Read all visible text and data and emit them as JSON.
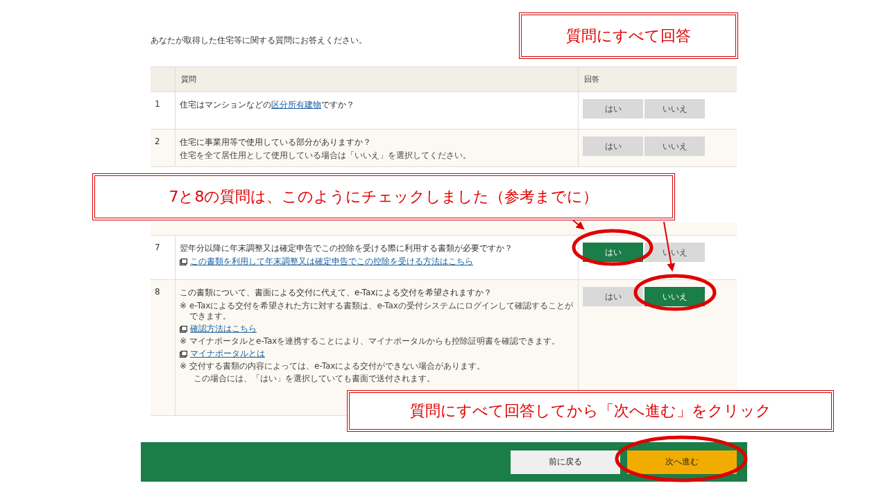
{
  "intro": "あなたが取得した住宅等に関する質問にお答えください。",
  "table": {
    "columns": [
      "質問",
      "回答"
    ],
    "rows": [
      {
        "number": "1",
        "question": [
          {
            "kind": "text",
            "text": "住宅はマンションなどの"
          },
          {
            "kind": "link",
            "text": "区分所有建物"
          },
          {
            "kind": "text",
            "text": "ですか？"
          }
        ],
        "details": [],
        "answers": [
          {
            "label": "はい",
            "selected": false
          },
          {
            "label": "いいえ",
            "selected": false
          }
        ]
      },
      {
        "number": "2",
        "question": [
          {
            "kind": "text",
            "text": "住宅に事業用等で使用している部分がありますか？"
          }
        ],
        "details": [
          {
            "kind": "plain",
            "text": "住宅を全て居住用として使用している場合は「いいえ」を選択してください。"
          }
        ],
        "answers": [
          {
            "label": "はい",
            "selected": false
          },
          {
            "label": "いいえ",
            "selected": false
          }
        ]
      },
      {
        "number": "7",
        "question": [
          {
            "kind": "text",
            "text": "翌年分以降に年末調整又は確定申告でこの控除を受ける際に利用する書類が必要ですか？"
          }
        ],
        "details": [
          {
            "kind": "link",
            "text": "この書類を利用して年末調整又は確定申告でこの控除を受ける方法はこちら"
          }
        ],
        "answers": [
          {
            "label": "はい",
            "selected": true
          },
          {
            "label": "いいえ",
            "selected": false
          }
        ]
      },
      {
        "number": "8",
        "question": [
          {
            "kind": "text",
            "text": "この書類について、書面による交付に代えて、e-Taxによる交付を希望されますか？"
          }
        ],
        "details": [
          {
            "kind": "note",
            "mark": "※",
            "text": "e-Taxによる交付を希望された方に対する書類は、e-Taxの受付システムにログインして確認することができます。"
          },
          {
            "kind": "link",
            "text": "確認方法はこちら"
          },
          {
            "kind": "note",
            "mark": "※",
            "text": "マイナポータルとe-Taxを連携することにより、マイナポータルからも控除証明書を確認できます。"
          },
          {
            "kind": "link",
            "text": "マイナポータルとは"
          },
          {
            "kind": "note",
            "mark": "※",
            "text": "交付する書類の内容によっては、e-Taxによる交付ができない場合があります。"
          },
          {
            "kind": "sub",
            "text": "この場合には、「はい」を選択していても書面で送付されます。"
          }
        ],
        "answers": [
          {
            "label": "はい",
            "selected": false
          },
          {
            "label": "いいえ",
            "selected": true
          }
        ]
      }
    ]
  },
  "footer": {
    "buttons": [
      {
        "label": "前に戻る",
        "kind": "secondary"
      },
      {
        "label": "次へ進む",
        "kind": "primary"
      }
    ]
  },
  "callouts": [
    {
      "text": "質問にすべて回答"
    },
    {
      "text": "7と8の質問は、このようにチェックしました（参考までに）"
    },
    {
      "text": "質問にすべて回答してから「次へ進む」をクリック"
    }
  ]
}
